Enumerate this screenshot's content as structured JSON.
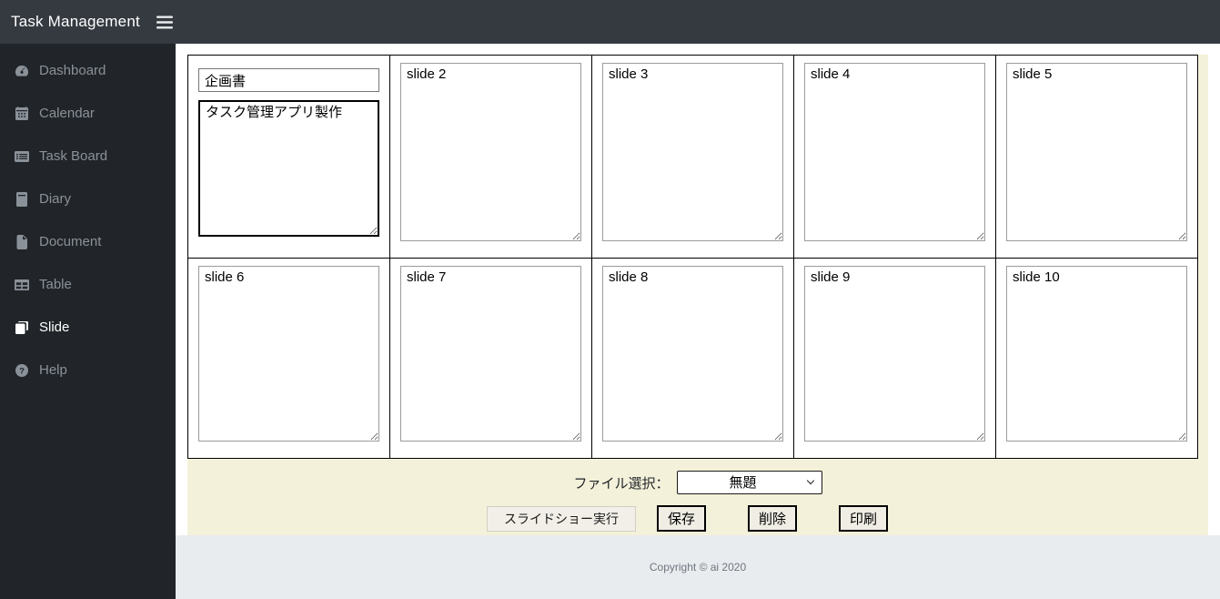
{
  "topbar": {
    "title": "Task Management"
  },
  "sidebar": {
    "items": [
      {
        "label": "Dashboard",
        "icon": "tachometer-icon",
        "active": false
      },
      {
        "label": "Calendar",
        "icon": "calendar-icon",
        "active": false
      },
      {
        "label": "Task Board",
        "icon": "board-icon",
        "active": false
      },
      {
        "label": "Diary",
        "icon": "book-icon",
        "active": false
      },
      {
        "label": "Document",
        "icon": "file-icon",
        "active": false
      },
      {
        "label": "Table",
        "icon": "table-icon",
        "active": false
      },
      {
        "label": "Slide",
        "icon": "slides-icon",
        "active": true
      },
      {
        "label": "Help",
        "icon": "question-icon",
        "active": false
      }
    ]
  },
  "slides": {
    "first": {
      "title": "企画書",
      "content": "タスク管理アプリ製作"
    },
    "items": [
      {
        "text": "slide 2"
      },
      {
        "text": "slide 3"
      },
      {
        "text": "slide 4"
      },
      {
        "text": "slide 5"
      },
      {
        "text": "slide 6"
      },
      {
        "text": "slide 7"
      },
      {
        "text": "slide 8"
      },
      {
        "text": "slide 9"
      },
      {
        "text": "slide 10"
      }
    ]
  },
  "controls": {
    "file_select_label": "ファイル選択：",
    "file_select_value": "無題",
    "slideshow_button": "スライドショー実行",
    "save_button": "保存",
    "delete_button": "削除",
    "print_button": "印刷"
  },
  "footer": {
    "copyright": "Copyright © ai 2020"
  },
  "colors": {
    "topbar": "#343a40",
    "sidebar": "#212529",
    "sidebar_text": "#8a9199",
    "active_text": "#ffffff",
    "panel_bg": "#f4f1da",
    "footer_bg": "#e9ecef",
    "table_border": "#000000"
  }
}
